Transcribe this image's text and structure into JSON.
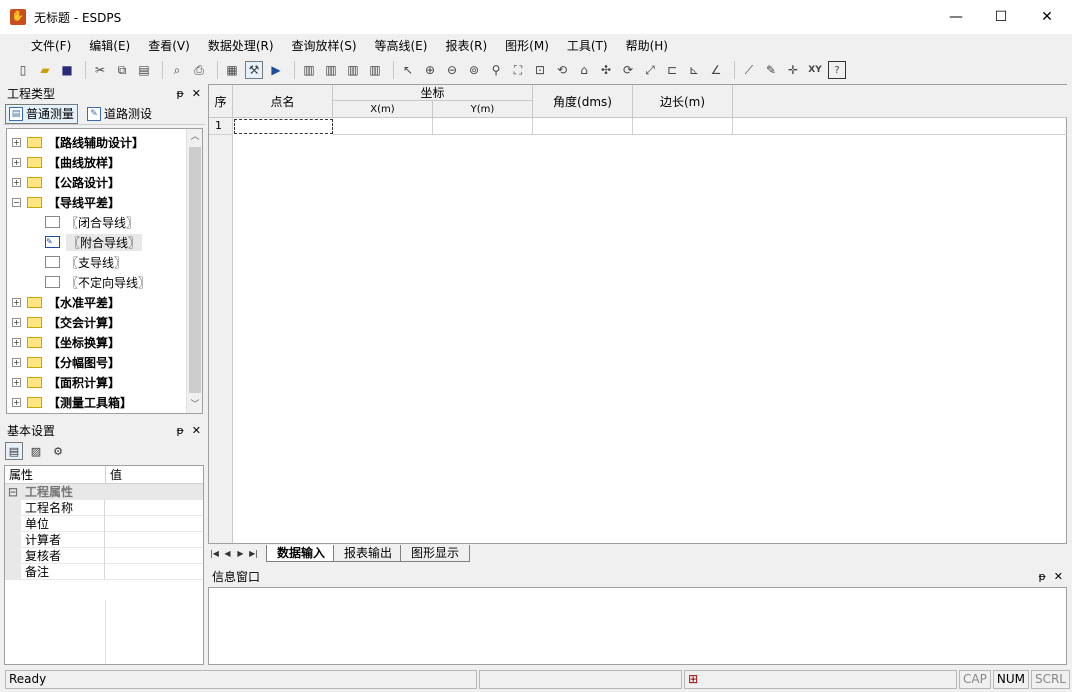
{
  "window": {
    "title": "无标题 - ESDPS",
    "minimize": "—",
    "maximize": "☐",
    "close": "✕"
  },
  "menu": [
    "文件(F)",
    "编辑(E)",
    "查看(V)",
    "数据处理(R)",
    "查询放样(S)",
    "等高线(E)",
    "报表(R)",
    "图形(M)",
    "工具(T)",
    "帮助(H)"
  ],
  "left_panel": {
    "title": "工程类型",
    "pin": "ᵽ",
    "close": "✕",
    "tabs": [
      {
        "label": "普通测量",
        "icon": "survey-icon"
      },
      {
        "label": "道路测设",
        "icon": "road-icon"
      }
    ],
    "tree": [
      {
        "label": "【路线辅助设计】",
        "expand": "+"
      },
      {
        "label": "【曲线放样】",
        "expand": "+"
      },
      {
        "label": "【公路设计】",
        "expand": "+"
      },
      {
        "label": "【导线平差】",
        "expand": "−",
        "children": [
          {
            "label": "〖闭合导线〗"
          },
          {
            "label": "〖附合导线〗",
            "selected": true
          },
          {
            "label": "〖支导线〗"
          },
          {
            "label": "〖不定向导线〗"
          }
        ]
      },
      {
        "label": "【水准平差】",
        "expand": "+"
      },
      {
        "label": "【交会计算】",
        "expand": "+"
      },
      {
        "label": "【坐标换算】",
        "expand": "+"
      },
      {
        "label": "【分幅图号】",
        "expand": "+"
      },
      {
        "label": "【面积计算】",
        "expand": "+"
      },
      {
        "label": "【测量工具箱】",
        "expand": "+"
      }
    ]
  },
  "basic_panel": {
    "title": "基本设置",
    "columns": [
      "属性",
      "值"
    ],
    "category": "工程属性",
    "props": [
      "工程名称",
      "单位",
      "计算者",
      "复核者",
      "备注"
    ]
  },
  "grid": {
    "headers": {
      "seq": "序",
      "name": "点名",
      "coord": "坐标",
      "x": "X(m)",
      "y": "Y(m)",
      "angle": "角度(dms)",
      "dist": "边长(m)"
    },
    "rows": [
      {
        "seq": "1"
      }
    ]
  },
  "sheet_tabs": [
    "数据输入",
    "报表输出",
    "图形显示"
  ],
  "info_panel": {
    "title": "信息窗口"
  },
  "status": {
    "ready": "Ready",
    "cap": "CAP",
    "num": "NUM",
    "scrl": "SCRL"
  }
}
